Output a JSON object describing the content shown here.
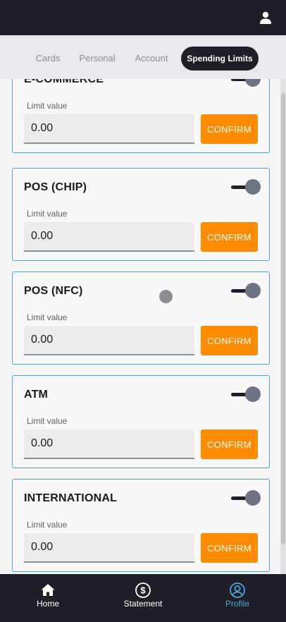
{
  "header": {
    "user_icon": "user-icon"
  },
  "tabs": [
    {
      "label": "Cards",
      "active": false
    },
    {
      "label": "Personal",
      "active": false
    },
    {
      "label": "Account",
      "active": false
    },
    {
      "label": "Spending Limits",
      "active": true
    }
  ],
  "limits": {
    "input_label": "Limit value",
    "confirm_label": "CONFIRM",
    "cards": [
      {
        "title": "E-COMMERCE",
        "value": "0.00",
        "enabled": true
      },
      {
        "title": "POS (CHIP)",
        "value": "0.00",
        "enabled": true
      },
      {
        "title": "POS (NFC)",
        "value": "0.00",
        "enabled": true
      },
      {
        "title": "ATM",
        "value": "0.00",
        "enabled": true
      },
      {
        "title": "INTERNATIONAL",
        "value": "0.00",
        "enabled": true
      }
    ]
  },
  "bottom_nav": [
    {
      "label": "Home",
      "icon": "home-icon",
      "active": false
    },
    {
      "label": "Statement",
      "icon": "dollar-circle-icon",
      "active": false
    },
    {
      "label": "Profile",
      "icon": "profile-icon",
      "active": true
    }
  ],
  "colors": {
    "accent": "#ff8c00",
    "active_nav": "#4ba3dc",
    "dark": "#1f2027",
    "card_border": "#4ba3dc"
  }
}
